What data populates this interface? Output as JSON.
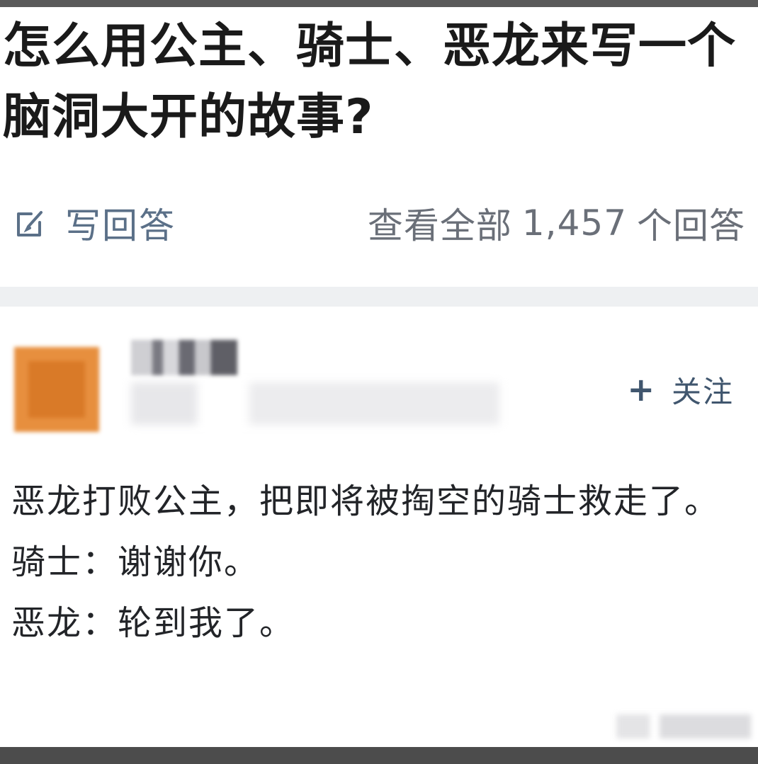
{
  "question": {
    "title": "怎么用公主、骑士、恶龙来写一个脑洞大开的故事?"
  },
  "actions": {
    "write_answer_label": "写回答",
    "view_all_prefix": "查看全部",
    "answer_count": "1,457",
    "view_all_suffix": "个回答"
  },
  "answer": {
    "follow_label": "关注",
    "paragraphs": [
      "恶龙打败公主，把即将被掏空的骑士救走了。",
      "骑士：谢谢你。",
      "恶龙：轮到我了。"
    ]
  },
  "colors": {
    "title": "#1a1a1a",
    "action": "#5b7088",
    "divider": "#eef0f2",
    "avatar": "#e78f3e",
    "follow": "#40566e"
  },
  "icons": {
    "write": "pencil-square-icon",
    "follow": "plus-icon"
  }
}
